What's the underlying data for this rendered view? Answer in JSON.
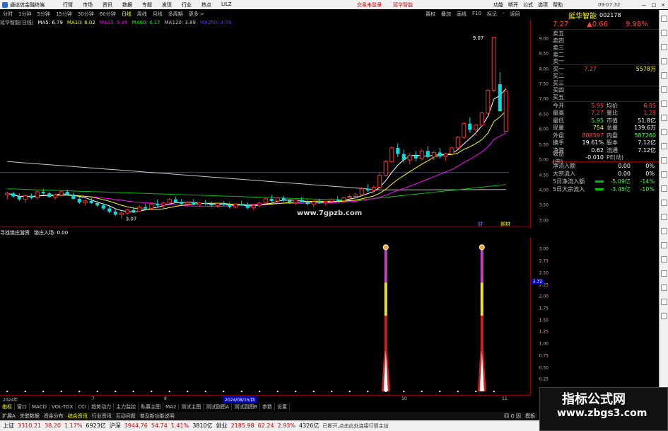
{
  "titlebar": {
    "app_title": "通达信金融终端",
    "menu": [
      "行情",
      "市场",
      "资讯",
      "数据",
      "专题",
      "发现",
      "行业",
      "热点",
      "LILZ"
    ],
    "center_links": [
      "交易未登录",
      "延华智能"
    ],
    "right_menu": [
      "功能",
      "断开",
      "公式",
      "选项",
      "帮助"
    ],
    "clock": "09:07:32",
    "window_buttons": [
      "—",
      "□",
      "×"
    ]
  },
  "periodbar": {
    "items": [
      "分时",
      "1分钟",
      "5分钟",
      "15分钟",
      "30分钟",
      "60分钟",
      "日线",
      "周线",
      "月线",
      "多周期",
      "更多 >"
    ],
    "selected": "日线",
    "tools": [
      "置权",
      "叠加",
      "画线",
      "F10",
      "标记",
      "-",
      "返回"
    ]
  },
  "ma_legend": {
    "stock": "延华智能(日线)",
    "items": [
      {
        "label": "MA5: 6.79",
        "color": "#ffffff"
      },
      {
        "label": "MA10: 6.02",
        "color": "#ffff00"
      },
      {
        "label": "MA20: 5.46",
        "color": "#ff00ff"
      },
      {
        "label": "MA60: 4.17",
        "color": "#00ff00"
      },
      {
        "label": "MA120: 3.89",
        "color": "#c8c8c8"
      },
      {
        "label": "MA250: 4.59",
        "color": "#4040ff"
      }
    ]
  },
  "sub_legend": {
    "items": [
      "寻找锁庄游资",
      "锁庄入场: 0.00"
    ]
  },
  "chart_labels": {
    "high_label": "9.07",
    "low_label": "3.07",
    "tag1": "财",
    "tag2": "题材"
  },
  "watermark_center": "www.7gpzb.com",
  "main_yaxis": [
    "9.00",
    "8.50",
    "8.00",
    "7.50",
    "7.00",
    "6.50",
    "6.00",
    "5.50",
    "5.00",
    "4.50",
    "4.00",
    "3.50",
    "3.00"
  ],
  "sub_yaxis": [
    "3.00",
    "2.75",
    "2.50",
    "2.25",
    "2.00",
    "1.75",
    "1.50",
    "1.25",
    "1.00",
    "0.75",
    "0.50",
    "0.25"
  ],
  "sub_cursor_value": "2.32",
  "date_axis": {
    "labels": [
      "2024年",
      "7",
      "8",
      "2024/08/15/四",
      "10",
      "11"
    ],
    "current": "2024/08/15/四"
  },
  "bottom_tabs": {
    "items": [
      "指标",
      "窗口",
      "MACD",
      "VOL-TDX",
      "CCI",
      "趋势动力",
      "主力监控",
      "私募主图",
      "MA2",
      "测试主图",
      "测试副图A",
      "测试副图B",
      "参数",
      "设置"
    ],
    "selected": "指标"
  },
  "bottom_tabs2": {
    "items": [
      "扩展A",
      "关联数据",
      "资金分布",
      "综合资讯",
      "行业资讯",
      "互动问题",
      "普及新功能说明"
    ],
    "right": [
      "四 G 因",
      "模板"
    ]
  },
  "statusbar": {
    "items": [
      {
        "name": "上证",
        "value": "3310.21",
        "chg": "38.20",
        "pct": "1.17%",
        "amt": "6923亿"
      },
      {
        "name": "沪深",
        "value": "3944.76",
        "chg": "54.74",
        "pct": "1.41%",
        "amt": "3810亿"
      },
      {
        "name": "创业",
        "value": "2185.98",
        "chg": "62.24",
        "pct": "2.93%",
        "amt": "4326亿"
      }
    ],
    "tail": "已断开,点击此处连接行情主站"
  },
  "quote": {
    "name": "延华智能",
    "code": "002178",
    "price": "7.27",
    "change": "▲0.66",
    "pct": "9.98%",
    "asks": [
      {
        "label": "卖五",
        "price": "",
        "vol": ""
      },
      {
        "label": "卖四",
        "price": "",
        "vol": ""
      },
      {
        "label": "卖三",
        "price": "",
        "vol": ""
      },
      {
        "label": "卖二",
        "price": "",
        "vol": ""
      },
      {
        "label": "卖一",
        "price": "",
        "vol": ""
      }
    ],
    "bids": [
      {
        "label": "买一",
        "price": "7.27",
        "vol": "5578万"
      },
      {
        "label": "买二",
        "price": "",
        "vol": ""
      },
      {
        "label": "买三",
        "price": "",
        "vol": ""
      },
      {
        "label": "买四",
        "price": "",
        "vol": ""
      },
      {
        "label": "买五",
        "price": "",
        "vol": ""
      }
    ],
    "stats": [
      {
        "k1": "今开",
        "v1": "5.95",
        "c1": "red",
        "k2": "均价",
        "v2": "6.85",
        "c2": "red"
      },
      {
        "k1": "最高",
        "v1": "7.27",
        "c1": "red",
        "k2": "量比",
        "v2": "1.28",
        "c2": "red"
      },
      {
        "k1": "最低",
        "v1": "5.95",
        "c1": "grn",
        "k2": "市值",
        "v2": "51.8亿",
        "c2": "wht"
      },
      {
        "k1": "现量",
        "v1": "754",
        "c1": "yel",
        "k2": "总量",
        "v2": "139.6万",
        "c2": "wht"
      },
      {
        "k1": "外盘",
        "v1": "808597",
        "c1": "red",
        "k2": "内盘",
        "v2": "587260",
        "c2": "grn"
      },
      {
        "k1": "换手",
        "v1": "19.61%",
        "c1": "wht",
        "k2": "股本",
        "v2": "7.12亿",
        "c2": "wht"
      },
      {
        "k1": "净资",
        "v1": "0.62",
        "c1": "wht",
        "k2": "流通",
        "v2": "7.12亿",
        "c2": "wht"
      },
      {
        "k1": "收益(中)",
        "v1": "-0.010",
        "c1": "wht",
        "k2": "PE(动)",
        "v2": "",
        "c2": "wht"
      }
    ],
    "flows": [
      {
        "label": "净流入额",
        "v1": "0.00",
        "v2": "0%",
        "bar": ""
      },
      {
        "label": "大宗流入",
        "v1": "0.00",
        "v2": "0%",
        "bar": ""
      },
      {
        "label": "5日净流入额",
        "v1": "-5.09亿",
        "v2": "-14%",
        "bar": "#00c000"
      },
      {
        "label": "5日大宗流入",
        "v1": "-3.45亿",
        "v2": "-10%",
        "bar": "#00c000"
      }
    ]
  },
  "watermark": {
    "title": "指标公式网",
    "url": "www.zbgs3.com"
  },
  "chart_data": [
    {
      "type": "candlestick",
      "title": "延华智能(日线)",
      "ylim": [
        2.9,
        9.3
      ],
      "candles": [
        [
          3.85,
          3.95,
          3.7,
          3.9
        ],
        [
          3.9,
          3.95,
          3.75,
          3.8
        ],
        [
          3.8,
          3.9,
          3.65,
          3.7
        ],
        [
          3.7,
          3.85,
          3.6,
          3.82
        ],
        [
          3.82,
          3.9,
          3.7,
          3.75
        ],
        [
          3.75,
          4.0,
          3.7,
          3.95
        ],
        [
          3.95,
          4.05,
          3.85,
          3.9
        ],
        [
          3.9,
          3.95,
          3.75,
          3.78
        ],
        [
          3.78,
          3.9,
          3.7,
          3.85
        ],
        [
          3.85,
          4.0,
          3.8,
          3.95
        ],
        [
          3.95,
          4.02,
          3.82,
          3.86
        ],
        [
          3.86,
          3.92,
          3.7,
          3.72
        ],
        [
          3.72,
          3.8,
          3.55,
          3.6
        ],
        [
          3.6,
          3.7,
          3.5,
          3.65
        ],
        [
          3.65,
          3.75,
          3.55,
          3.58
        ],
        [
          3.58,
          3.66,
          3.45,
          3.5
        ],
        [
          3.5,
          3.58,
          3.35,
          3.4
        ],
        [
          3.4,
          3.5,
          3.25,
          3.3
        ],
        [
          3.3,
          3.4,
          3.15,
          3.2
        ],
        [
          3.2,
          3.3,
          3.07,
          3.25
        ],
        [
          3.25,
          3.4,
          3.2,
          3.35
        ],
        [
          3.35,
          3.45,
          3.25,
          3.3
        ],
        [
          3.3,
          3.5,
          3.28,
          3.45
        ],
        [
          3.45,
          3.55,
          3.35,
          3.4
        ],
        [
          3.4,
          3.6,
          3.38,
          3.55
        ],
        [
          3.55,
          3.7,
          3.45,
          3.5
        ],
        [
          3.5,
          3.62,
          3.4,
          3.58
        ],
        [
          3.58,
          3.75,
          3.55,
          3.7
        ],
        [
          3.7,
          3.8,
          3.58,
          3.62
        ],
        [
          3.62,
          3.72,
          3.5,
          3.55
        ],
        [
          3.55,
          3.65,
          3.45,
          3.6
        ],
        [
          3.6,
          3.7,
          3.5,
          3.52
        ],
        [
          3.52,
          3.62,
          3.45,
          3.58
        ],
        [
          3.58,
          3.68,
          3.5,
          3.55
        ],
        [
          3.55,
          3.63,
          3.45,
          3.5
        ],
        [
          3.5,
          3.6,
          3.42,
          3.56
        ],
        [
          3.56,
          3.64,
          3.48,
          3.52
        ],
        [
          3.52,
          3.6,
          3.4,
          3.45
        ],
        [
          3.45,
          3.58,
          3.4,
          3.55
        ],
        [
          3.55,
          3.66,
          3.48,
          3.5
        ],
        [
          3.5,
          3.6,
          3.38,
          3.42
        ],
        [
          3.42,
          3.55,
          3.35,
          3.5
        ],
        [
          3.5,
          3.62,
          3.45,
          3.58
        ],
        [
          3.58,
          3.75,
          3.55,
          3.72
        ],
        [
          3.72,
          3.85,
          3.6,
          3.65
        ],
        [
          3.65,
          3.78,
          3.58,
          3.75
        ],
        [
          3.75,
          3.82,
          3.62,
          3.66
        ],
        [
          3.66,
          3.72,
          3.55,
          3.6
        ],
        [
          3.6,
          3.7,
          3.52,
          3.68
        ],
        [
          3.68,
          3.78,
          3.6,
          3.62
        ],
        [
          3.62,
          3.7,
          3.5,
          3.55
        ],
        [
          3.55,
          3.65,
          3.45,
          3.62
        ],
        [
          3.62,
          3.72,
          3.55,
          3.58
        ],
        [
          3.58,
          3.66,
          3.5,
          3.64
        ],
        [
          3.64,
          3.75,
          3.58,
          3.7
        ],
        [
          3.7,
          3.8,
          3.62,
          3.66
        ],
        [
          3.66,
          3.78,
          3.6,
          3.75
        ],
        [
          3.75,
          3.86,
          3.68,
          3.8
        ],
        [
          3.8,
          3.92,
          3.72,
          3.85
        ],
        [
          3.85,
          4.1,
          3.8,
          4.05
        ],
        [
          4.05,
          4.2,
          3.95,
          4.0
        ],
        [
          4.0,
          4.15,
          3.92,
          4.1
        ],
        [
          4.1,
          4.6,
          4.05,
          4.5
        ],
        [
          4.5,
          5.0,
          4.45,
          4.95
        ],
        [
          4.95,
          5.45,
          4.9,
          5.4
        ],
        [
          5.4,
          5.55,
          5.1,
          5.2
        ],
        [
          5.2,
          5.35,
          4.9,
          5.0
        ],
        [
          5.0,
          5.25,
          4.85,
          5.15
        ],
        [
          5.15,
          5.3,
          4.95,
          5.05
        ],
        [
          5.05,
          5.35,
          5.0,
          5.3
        ],
        [
          5.3,
          5.45,
          5.05,
          5.1
        ],
        [
          5.1,
          5.3,
          5.0,
          5.25
        ],
        [
          5.25,
          5.4,
          5.05,
          5.12
        ],
        [
          5.12,
          5.25,
          4.98,
          5.2
        ],
        [
          5.2,
          5.45,
          5.15,
          5.4
        ],
        [
          5.4,
          5.8,
          5.35,
          5.75
        ],
        [
          5.75,
          6.25,
          5.7,
          6.2
        ],
        [
          6.2,
          6.4,
          5.9,
          6.0
        ],
        [
          6.0,
          6.2,
          5.8,
          6.15
        ],
        [
          6.15,
          6.6,
          6.1,
          6.55
        ],
        [
          6.55,
          7.35,
          6.5,
          7.3
        ],
        [
          7.3,
          9.07,
          7.25,
          9.05
        ],
        [
          7.5,
          7.9,
          6.61,
          6.61
        ],
        [
          5.95,
          7.27,
          5.95,
          7.27
        ]
      ],
      "ma_lines": {
        "MA5": 6.79,
        "MA10": 6.02,
        "MA20": 5.46,
        "MA60": 4.17,
        "MA120": 3.89,
        "MA250": 4.59
      }
    },
    {
      "type": "bar",
      "title": "寻找锁庄游资",
      "ylim": [
        0,
        3.2
      ],
      "signals": [
        {
          "index": 63,
          "value": 3.0
        },
        {
          "index": 79,
          "value": 3.0
        }
      ]
    }
  ]
}
